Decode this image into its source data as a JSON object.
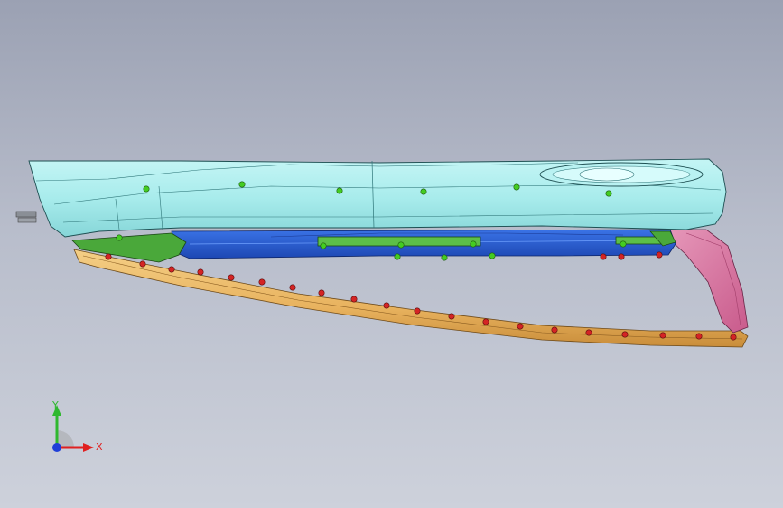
{
  "viewport": {
    "background_top": "#9ba1b3",
    "background_bottom": "#cdd1db"
  },
  "model": {
    "parts": [
      {
        "name": "cyan-trim-panel",
        "color": "#a8ecec"
      },
      {
        "name": "blue-inner-channel",
        "color": "#2f62d6"
      },
      {
        "name": "green-bracket",
        "color": "#4aa83a"
      },
      {
        "name": "orange-strip",
        "color": "#e8b25e"
      },
      {
        "name": "pink-end-cap",
        "color": "#d9709e"
      }
    ],
    "fastener_colors": {
      "green": "#44cc22",
      "red": "#d42424"
    }
  },
  "triad": {
    "x_label": "X",
    "y_label": "Y",
    "x_color": "#e02020",
    "y_color": "#2fb82f",
    "z_color": "#1f3fd8"
  }
}
